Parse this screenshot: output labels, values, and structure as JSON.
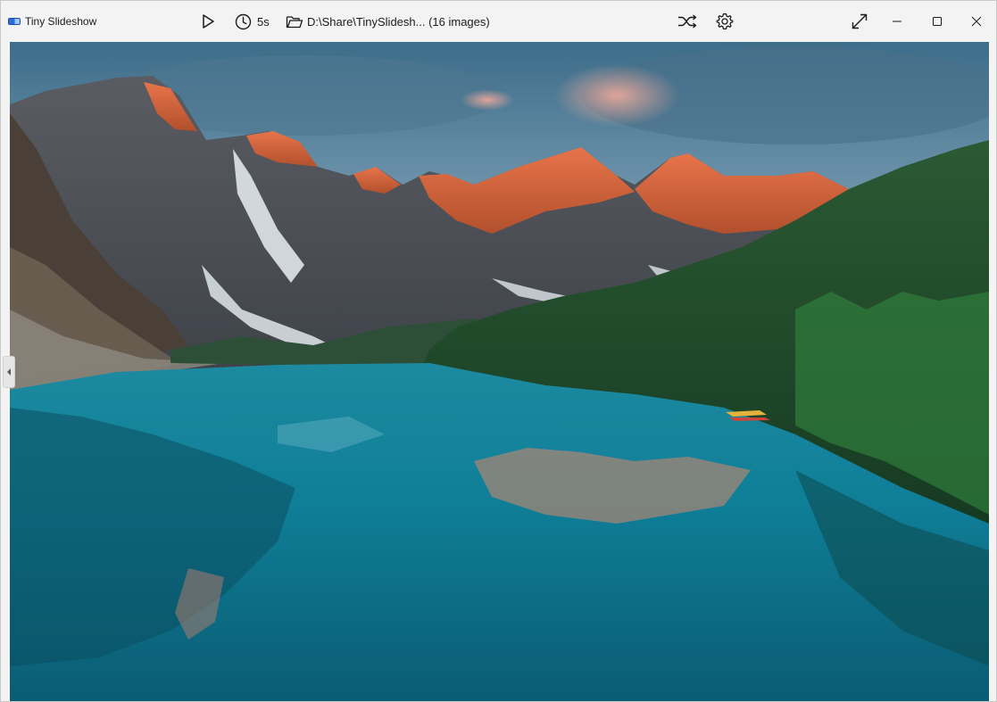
{
  "window": {
    "app_title": "Tiny Slideshow"
  },
  "toolbar": {
    "play_icon": "play-icon",
    "interval_label": "5s",
    "folder_label": "D:\\Share\\TinySlidesh... (16 images)",
    "shuffle_icon": "shuffle-icon",
    "settings_icon": "gear-icon",
    "fullscreen_icon": "expand-icon"
  },
  "window_controls": {
    "minimize_icon": "minimize-icon",
    "maximize_icon": "maximize-icon",
    "close_icon": "close-icon"
  },
  "slide": {
    "subject": "mountain-lake-photo"
  },
  "colors": {
    "titlebar_bg": "#f3f3f3",
    "icon": "#1b1b1b",
    "water": "#0c6f86",
    "peaks": "#e0663a"
  }
}
